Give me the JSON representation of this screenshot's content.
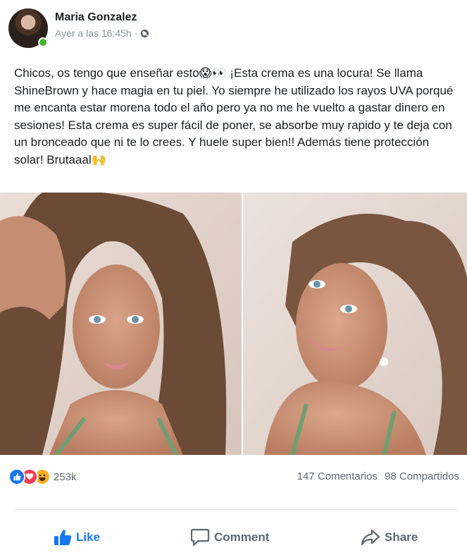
{
  "post": {
    "author": "Maria Gonzalez",
    "timestamp": "Ayer a las 16:45h",
    "separator": "·",
    "privacy_icon": "globe-icon",
    "text": "Chicos, os tengo que enseñar esto😱👀 ¡Esta crema es una locura! Se llama ShineBrown y hace magia en tu piel. Yo siempre he utilizado los rayos UVA porqué me encanta estar morena todo el año pero ya no me he vuelto a gastar dinero en sesiones! Esta crema es super fácil de poner, se absorbe muy rapido y te deja con un bronceado que ni te lo crees. Y huele super bien!! Además tiene protección solar! Brutaaal🙌"
  },
  "photos": [
    {
      "name": "selfie-left",
      "description_icon": "photo"
    },
    {
      "name": "selfie-right",
      "description_icon": "photo"
    }
  ],
  "stats": {
    "reactions": [
      "like",
      "love",
      "haha"
    ],
    "reaction_count": "253k",
    "comments": "147 Comentarios",
    "shares": "98 Compartidos"
  },
  "actions": {
    "like": "Like",
    "comment": "Comment",
    "share": "Share"
  },
  "colors": {
    "brand_blue": "#1877f2",
    "love_red": "#f33e58",
    "haha_yellow": "#f7b125",
    "online_green": "#42b72a",
    "muted_text": "#606770"
  }
}
